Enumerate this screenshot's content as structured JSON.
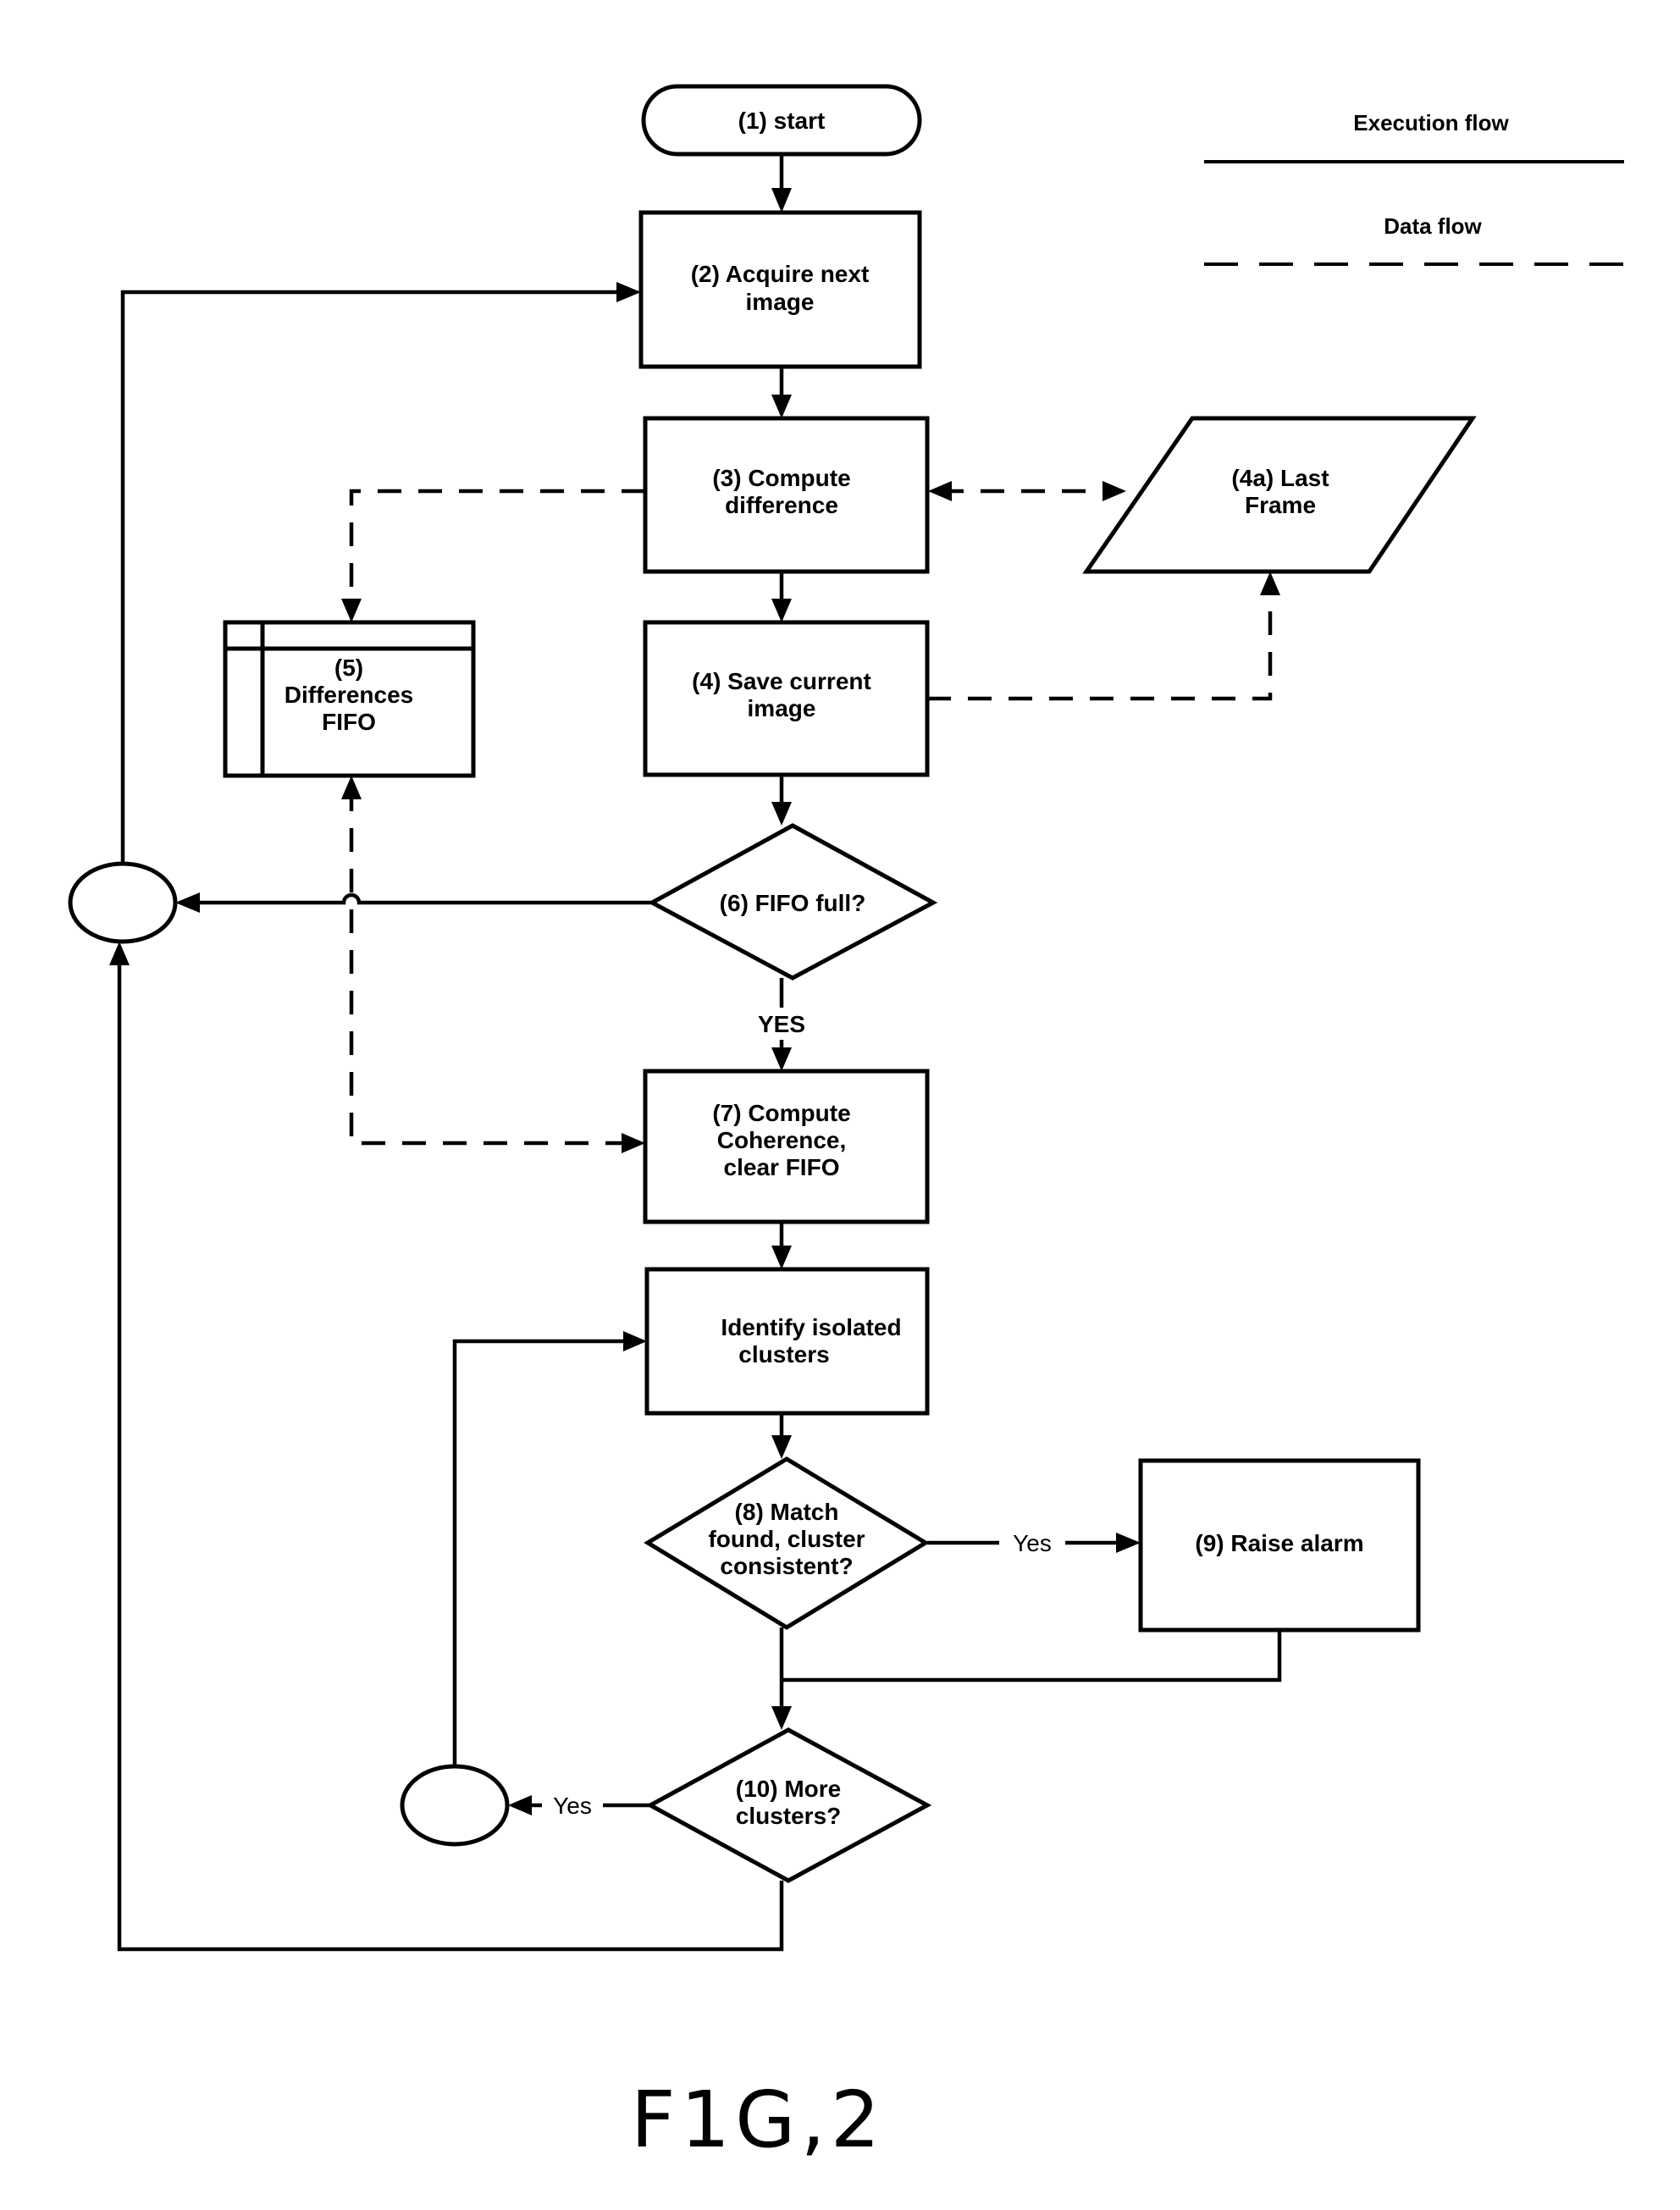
{
  "figure": {
    "caption": "FIG. 2",
    "caption_display": "F1G,2"
  },
  "legend": {
    "execution_flow": "Execution flow",
    "data_flow": "Data flow"
  },
  "nodes": {
    "start": {
      "type": "terminator",
      "lines": [
        "(1) start"
      ]
    },
    "acquire": {
      "type": "process",
      "lines": [
        "(2) Acquire next",
        "image"
      ]
    },
    "compute_diff": {
      "type": "process",
      "lines": [
        "(3) Compute",
        "difference"
      ]
    },
    "last_frame": {
      "type": "data",
      "lines": [
        "(4a) Last",
        "Frame"
      ]
    },
    "save_image": {
      "type": "process",
      "lines": [
        "(4) Save current",
        "image"
      ]
    },
    "fifo": {
      "type": "internal-storage",
      "lines": [
        "(5)",
        "Differences",
        "FIFO"
      ]
    },
    "fifo_full": {
      "type": "decision",
      "lines": [
        "(6) FIFO full?"
      ]
    },
    "coherence": {
      "type": "process",
      "lines": [
        "(7) Compute",
        "Coherence,",
        "clear FIFO"
      ]
    },
    "identify": {
      "type": "process",
      "lines": [
        "Identify isolated",
        "clusters"
      ]
    },
    "match": {
      "type": "decision",
      "lines": [
        "(8) Match",
        "found, cluster",
        "consistent?"
      ]
    },
    "alarm": {
      "type": "process",
      "lines": [
        "(9) Raise alarm"
      ]
    },
    "more_clusters": {
      "type": "decision",
      "lines": [
        "(10) More",
        "clusters?"
      ]
    },
    "connector_outer": {
      "type": "connector",
      "lines": []
    },
    "connector_inner": {
      "type": "connector",
      "lines": []
    }
  },
  "edge_labels": {
    "fifo_full_yes": "YES",
    "match_yes": "Yes",
    "more_yes": "Yes"
  },
  "edges": [
    {
      "from": "start",
      "to": "acquire",
      "kind": "execution"
    },
    {
      "from": "acquire",
      "to": "compute_diff",
      "kind": "execution"
    },
    {
      "from": "compute_diff",
      "to": "save_image",
      "kind": "execution"
    },
    {
      "from": "save_image",
      "to": "fifo_full",
      "kind": "execution"
    },
    {
      "from": "fifo_full",
      "to": "connector_outer",
      "kind": "execution"
    },
    {
      "from": "fifo_full",
      "to": "coherence",
      "kind": "execution",
      "label": "YES"
    },
    {
      "from": "connector_outer",
      "to": "acquire",
      "kind": "execution"
    },
    {
      "from": "coherence",
      "to": "identify",
      "kind": "execution"
    },
    {
      "from": "identify",
      "to": "match",
      "kind": "execution"
    },
    {
      "from": "match",
      "to": "alarm",
      "kind": "execution",
      "label": "Yes"
    },
    {
      "from": "match",
      "to": "more_clusters",
      "kind": "execution"
    },
    {
      "from": "alarm",
      "to": "more_clusters",
      "kind": "execution"
    },
    {
      "from": "more_clusters",
      "to": "connector_inner",
      "kind": "execution",
      "label": "Yes"
    },
    {
      "from": "connector_inner",
      "to": "identify",
      "kind": "execution"
    },
    {
      "from": "more_clusters",
      "to": "connector_outer",
      "kind": "execution"
    },
    {
      "from": "compute_diff",
      "to": "last_frame",
      "kind": "data",
      "bidirectional": true
    },
    {
      "from": "save_image",
      "to": "last_frame",
      "kind": "data"
    },
    {
      "from": "compute_diff",
      "to": "fifo",
      "kind": "data"
    },
    {
      "from": "fifo",
      "to": "coherence",
      "kind": "data"
    }
  ]
}
